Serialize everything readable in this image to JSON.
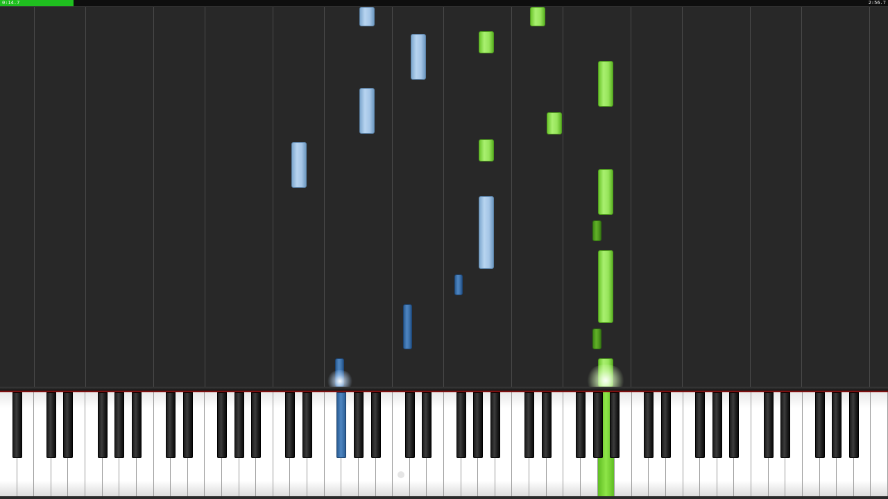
{
  "player": {
    "time_current": "0:14.7",
    "time_total": "2:56.7",
    "progress_fraction": 0.083
  },
  "colors": {
    "left_hand": "#a4c5e6",
    "right_hand": "#96e35a",
    "progress": "#1fbf1f",
    "background": "#282828"
  },
  "icons": {
    "center_dot": "record-dot-icon"
  }
}
